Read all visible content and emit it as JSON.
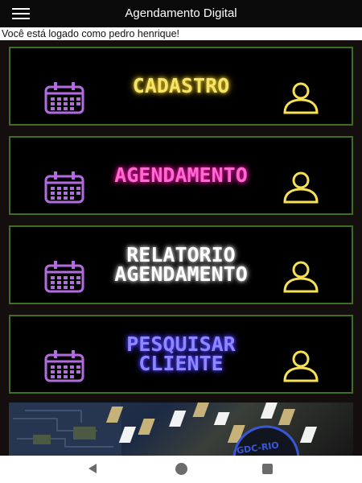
{
  "appbar": {
    "title": "Agendamento Digital",
    "menu_icon": "hamburger-menu-icon"
  },
  "status_line": "Você está logado como pedro henrique!",
  "menu": [
    {
      "label": "CADASTRO",
      "color": "#f4e46a",
      "glow": "#d8b820"
    },
    {
      "label": "AGENDAMENTO",
      "color": "#ff6ad0",
      "glow": "#e0109a"
    },
    {
      "label": "RELATORIO\nAGENDAMENTO",
      "color": "#ffffff",
      "glow": "#c9c9c9"
    },
    {
      "label": "PESQUISAR\nCLIENTE",
      "color": "#8f87ff",
      "glow": "#4a3cff"
    }
  ],
  "icons": {
    "calendar": "calendar-icon",
    "person": "person-icon",
    "calendar_color": "#b36be0",
    "person_color": "#f6e055"
  },
  "banner": {
    "logo_text": "GDC-RIO"
  },
  "colors": {
    "card_border": "#3d6f1f",
    "background": "#150e0e"
  },
  "nav": {
    "back_icon": "back-icon",
    "home_icon": "home-icon",
    "recent_icon": "recent-apps-icon"
  }
}
